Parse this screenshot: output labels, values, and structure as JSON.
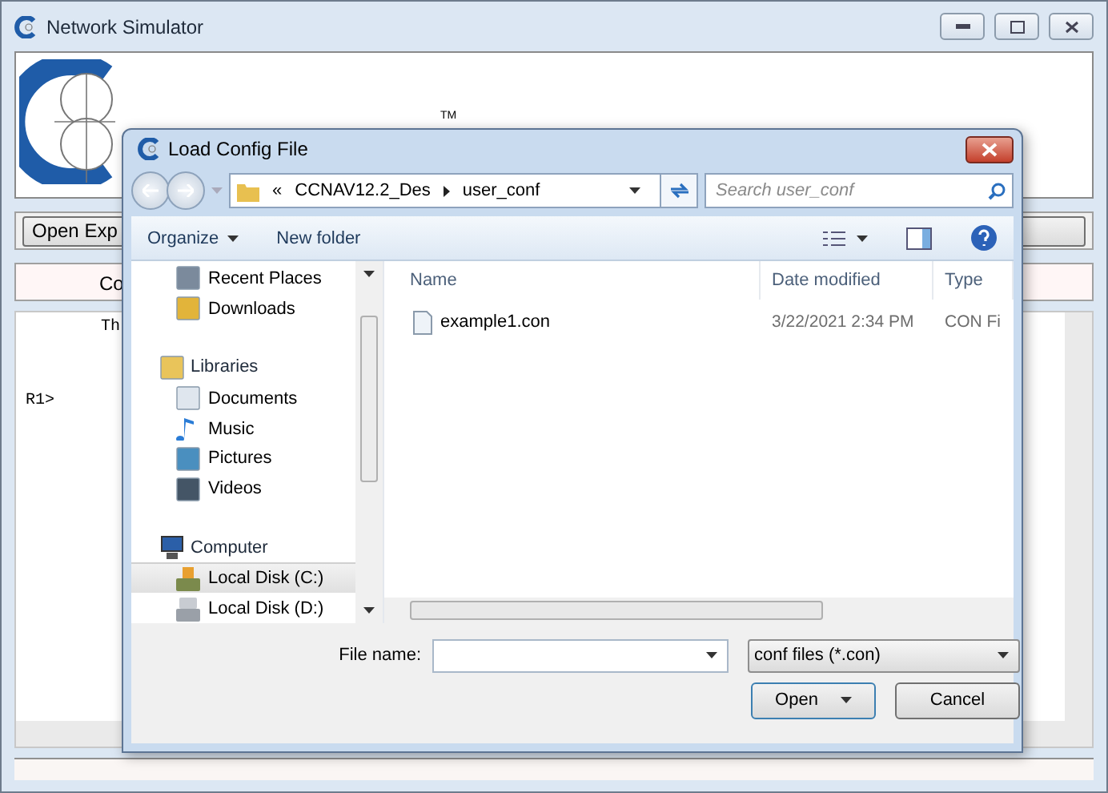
{
  "window": {
    "title": "Network Simulator",
    "logo_mark": "TM"
  },
  "toolbar": {
    "buttons": [
      "Open Exp"
    ]
  },
  "tabs": [
    {
      "label": "Co",
      "selected": false
    }
  ],
  "console": {
    "lines": [
      "Th",
      "R1>"
    ]
  },
  "dialog": {
    "title": "Load Config File",
    "address": {
      "prefix": "«",
      "path": [
        "CCNAV12.2_Des",
        "user_conf"
      ]
    },
    "search": {
      "placeholder": "Search user_conf"
    },
    "commands": [
      "Organize",
      "New folder"
    ],
    "nav": [
      {
        "items": [
          {
            "label": "Recent Places",
            "kind": "recent",
            "selected": false
          },
          {
            "label": "Downloads",
            "kind": "downloads",
            "selected": false
          }
        ]
      },
      {
        "label": "Libraries",
        "kind": "libraries",
        "items": [
          {
            "label": "Documents",
            "kind": "documents",
            "selected": false
          },
          {
            "label": "Music",
            "kind": "music",
            "selected": false
          },
          {
            "label": "Pictures",
            "kind": "pictures",
            "selected": false
          },
          {
            "label": "Videos",
            "kind": "videos",
            "selected": false
          }
        ]
      },
      {
        "label": "Computer",
        "kind": "computer",
        "items": [
          {
            "label": "Local Disk (C:)",
            "kind": "systemdisk",
            "selected": true
          },
          {
            "label": "Local Disk (D:)",
            "kind": "disk",
            "selected": false
          }
        ]
      }
    ],
    "columns": [
      "Name",
      "Date modified",
      "Type"
    ],
    "files": [
      {
        "name": "example1.con",
        "date": "3/22/2021 2:34 PM",
        "type": "CON Fi"
      }
    ],
    "file_name_label": "File name:",
    "filter": "conf files (*.con)",
    "buttons": [
      "Open",
      "Cancel"
    ]
  }
}
